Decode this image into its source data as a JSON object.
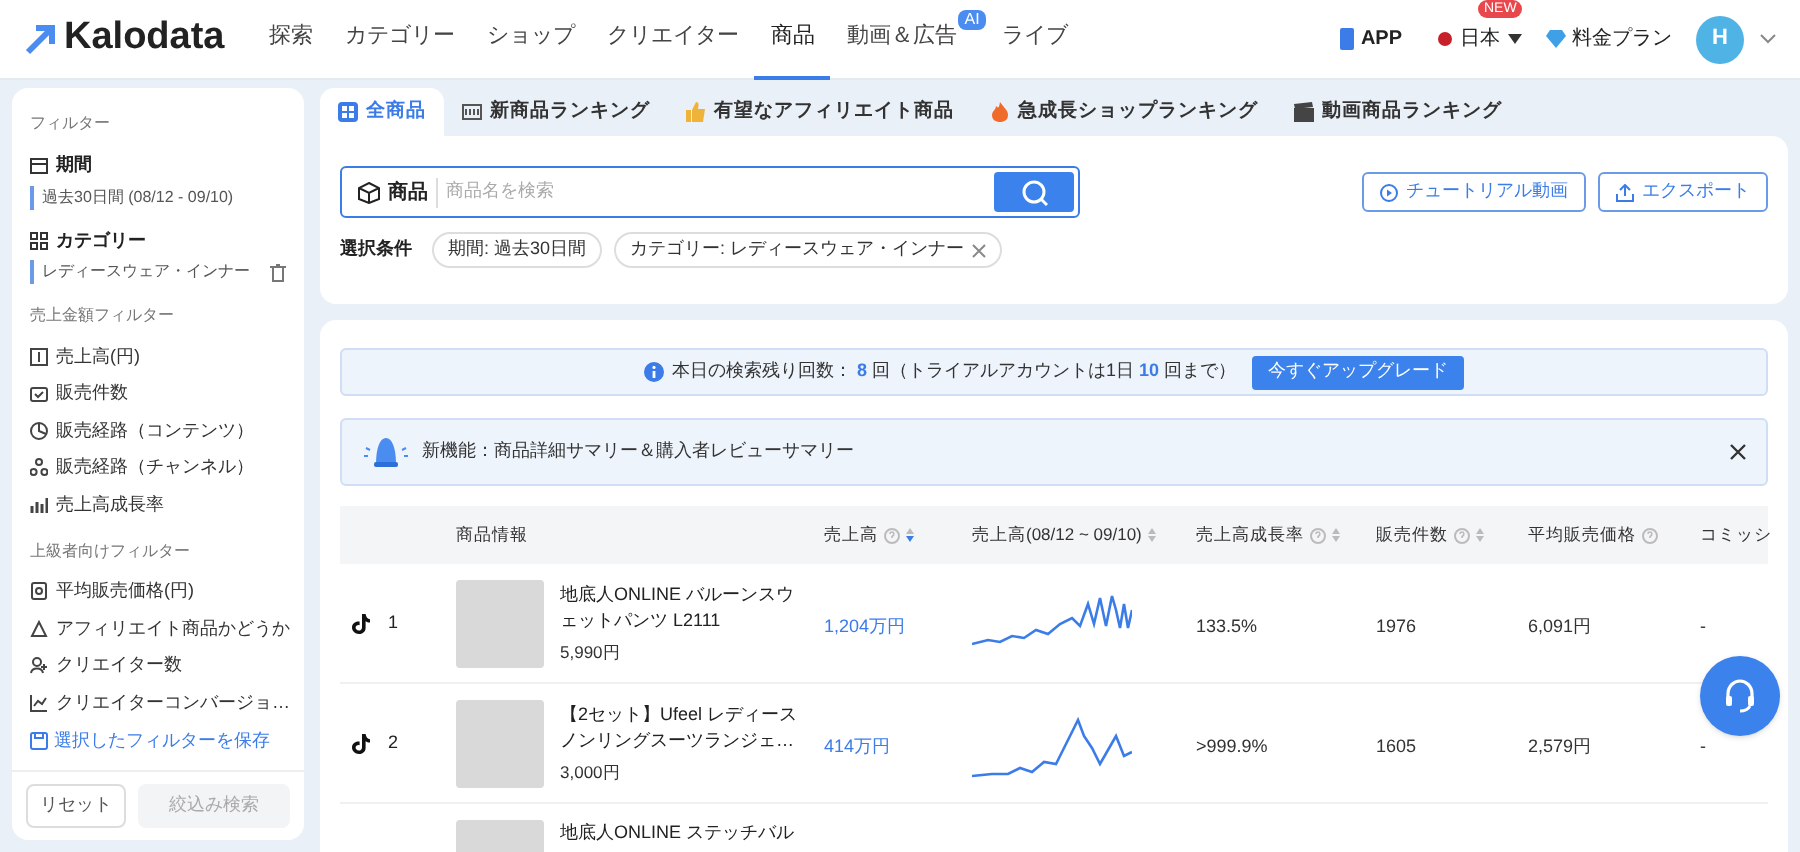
{
  "nav": {
    "logo": "Kalodata",
    "items": [
      {
        "label": "探索",
        "selected": false
      },
      {
        "label": "カテゴリー",
        "selected": false
      },
      {
        "label": "ショップ",
        "selected": false
      },
      {
        "label": "クリエイター",
        "selected": false
      },
      {
        "label": "商品",
        "selected": true
      },
      {
        "label": "動画＆広告",
        "selected": false,
        "badge": "AI"
      },
      {
        "label": "ライブ",
        "selected": false
      }
    ],
    "app": "APP",
    "region": "日本",
    "region_badge": "NEW",
    "plan": "料金プラン",
    "avatar": "H"
  },
  "sidebar": {
    "title": "フィルター",
    "period_label": "期間",
    "period_value": "過去30日間 (08/12 - 09/10)",
    "category_label": "カテゴリー",
    "category_value": "レディースウェア・インナー",
    "groups": [
      {
        "title": "売上金額フィルター",
        "items": [
          "売上高(円)",
          "販売件数",
          "販売経路（コンテンツ）",
          "販売経路（チャンネル）",
          "売上高成長率"
        ]
      },
      {
        "title": "上級者向けフィルター",
        "items": [
          "平均販売価格(円)",
          "アフィリエイト商品かどうか",
          "クリエイター数",
          "クリエイターコンバージョ…"
        ]
      }
    ],
    "save_link": "選択したフィルターを保存",
    "reset": "リセット",
    "search": "絞込み検索"
  },
  "tabs": [
    {
      "label": "全商品",
      "selected": true
    },
    {
      "label": "新商品ランキング",
      "selected": false
    },
    {
      "label": "有望なアフィリエイト商品",
      "selected": false
    },
    {
      "label": "急成長ショップランキング",
      "selected": false
    },
    {
      "label": "動画商品ランキング",
      "selected": false
    }
  ],
  "search": {
    "scope": "商品",
    "placeholder": "商品名を検索"
  },
  "tutorial": "チュートリアル動画",
  "export": "エクスポート",
  "conditions": {
    "label": "選択条件",
    "chips": [
      {
        "text": "期間: 過去30日間",
        "removable": false
      },
      {
        "text": "カテゴリー: レディースウェア・インナー",
        "removable": true
      }
    ]
  },
  "quota": {
    "before": "本日の検索残り回数：",
    "remaining": "8",
    "middle": "回（トライアルアカウントは1日",
    "limit": "10",
    "after": "回まで）",
    "upgrade": "今すぐアップグレード"
  },
  "announcement": "新機能：商品詳細サマリー＆購入者レビューサマリー",
  "table": {
    "columns": [
      {
        "label": "商品情報",
        "help": false,
        "sortable": false
      },
      {
        "label": "売上高",
        "help": true,
        "sortable": true,
        "sorted": true
      },
      {
        "label": "売上高(08/12 ~ 09/10)",
        "help": false,
        "sortable": true,
        "sorted": false
      },
      {
        "label": "売上高成長率",
        "help": true,
        "sortable": true,
        "sorted": false
      },
      {
        "label": "販売件数",
        "help": true,
        "sortable": true,
        "sorted": false
      },
      {
        "label": "平均販売価格",
        "help": true,
        "sortable": false
      },
      {
        "label": "コミッシ",
        "help": false,
        "sortable": false
      }
    ],
    "rows": [
      {
        "rank": "1",
        "name": "地底人ONLINE バルーンスウェットパンツ L2111",
        "price": "5,990円",
        "revenue": "1,204万円",
        "growth": "133.5%",
        "sold": "1976",
        "avg_price": "6,091円",
        "commission": "-"
      },
      {
        "rank": "2",
        "name": "【2セット】Ufeel レディースノンリングスーツランジェ…",
        "price": "3,000円",
        "revenue": "414万円",
        "growth": ">999.9%",
        "sold": "1605",
        "avg_price": "2,579円",
        "commission": "-"
      },
      {
        "name": "地底人ONLINE ステッチバル"
      }
    ]
  }
}
